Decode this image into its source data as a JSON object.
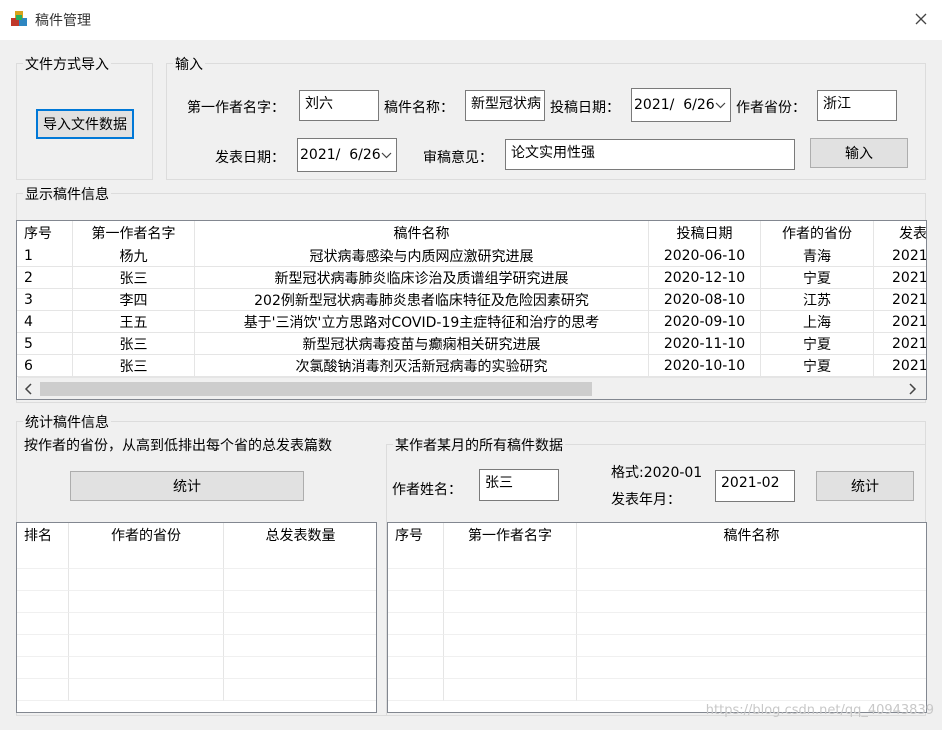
{
  "window": {
    "title": "稿件管理"
  },
  "import_group": {
    "label": "文件方式导入",
    "button": "导入文件数据"
  },
  "input_group": {
    "label": "输入",
    "author_label": "第一作者名字：",
    "author_value": "刘六",
    "title_label": "稿件名称：",
    "title_value": "新型冠状病",
    "submit_date_label": "投稿日期：",
    "submit_date_value": "2021/  6/26",
    "province_label": "作者省份：",
    "province_value": "浙江",
    "publish_date_label": "发表日期：",
    "publish_date_value": "2021/  6/26",
    "review_label": "审稿意见：",
    "review_value": "论文实用性强",
    "submit_button": "输入"
  },
  "display_group": {
    "label": "显示稿件信息",
    "columns": [
      "序号",
      "第一作者名字",
      "稿件名称",
      "投稿日期",
      "作者的省份",
      "发表"
    ],
    "rows": [
      [
        "1",
        "杨九",
        "冠状病毒感染与内质网应激研究进展",
        "2020-06-10",
        "青海",
        "2021"
      ],
      [
        "2",
        "张三",
        "新型冠状病毒肺炎临床诊治及质谱组学研究进展",
        "2020-12-10",
        "宁夏",
        "2021"
      ],
      [
        "3",
        "李四",
        "202例新型冠状病毒肺炎患者临床特征及危险因素研究",
        "2020-08-10",
        "江苏",
        "2021"
      ],
      [
        "4",
        "王五",
        "基于'三消饮'立方思路对COVID-19主症特征和治疗的思考",
        "2020-09-10",
        "上海",
        "2021"
      ],
      [
        "5",
        "张三",
        "新型冠状病毒疫苗与癫痫相关研究进展",
        "2020-11-10",
        "宁夏",
        "2021"
      ],
      [
        "6",
        "张三",
        "次氯酸钠消毒剂灭活新冠病毒的实验研究",
        "2020-10-10",
        "宁夏",
        "2021"
      ]
    ]
  },
  "stats_group": {
    "label": "统计稿件信息",
    "province_caption": "按作者的省份，从高到低排出每个省的总发表篇数",
    "province_button": "统计",
    "province_columns": [
      "排名",
      "作者的省份",
      "总发表数量"
    ],
    "month_group_label": "某作者某月的所有稿件数据",
    "author_name_label": "作者姓名：",
    "author_name_value": "张三",
    "format_label": "格式:2020-01",
    "month_label": "发表年月：",
    "month_value": "2021-02",
    "month_button": "统计",
    "month_columns": [
      "序号",
      "第一作者名字",
      "稿件名称"
    ]
  },
  "watermark": "https://blog.csdn.net/qq_40943839",
  "colors": {
    "focus": "#0078d7",
    "background": "#f0f0f0",
    "button": "#e1e1e1"
  },
  "icons": {
    "app": "app-cubes-icon",
    "close": "close-icon",
    "dropdown": "chevron-down-icon"
  }
}
